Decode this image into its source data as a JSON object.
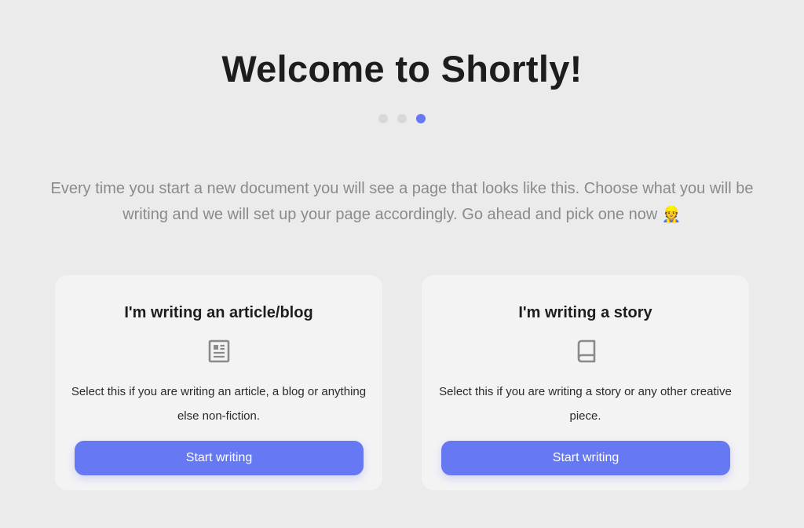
{
  "header": {
    "title": "Welcome to Shortly!",
    "steps": {
      "total": 3,
      "current": 3
    }
  },
  "intro": {
    "text": "Every time you start a new document you will see a page that looks like this. Choose what you will be writing and we will set up your page accordingly. Go ahead and pick one now 👷"
  },
  "cards": [
    {
      "title": "I'm writing an article/blog",
      "icon": "article-icon",
      "description": "Select this if you are writing an article, a blog or anything else non-fiction.",
      "button_label": "Start writing"
    },
    {
      "title": "I'm writing a story",
      "icon": "book-icon",
      "description": "Select this if you are writing a story or any other creative piece.",
      "button_label": "Start writing"
    }
  ],
  "colors": {
    "accent": "#6679f2",
    "background": "#ebebeb",
    "card": "#f3f3f4",
    "muted_text": "#8a8a8a",
    "inactive_dot": "#d8d8d8"
  }
}
